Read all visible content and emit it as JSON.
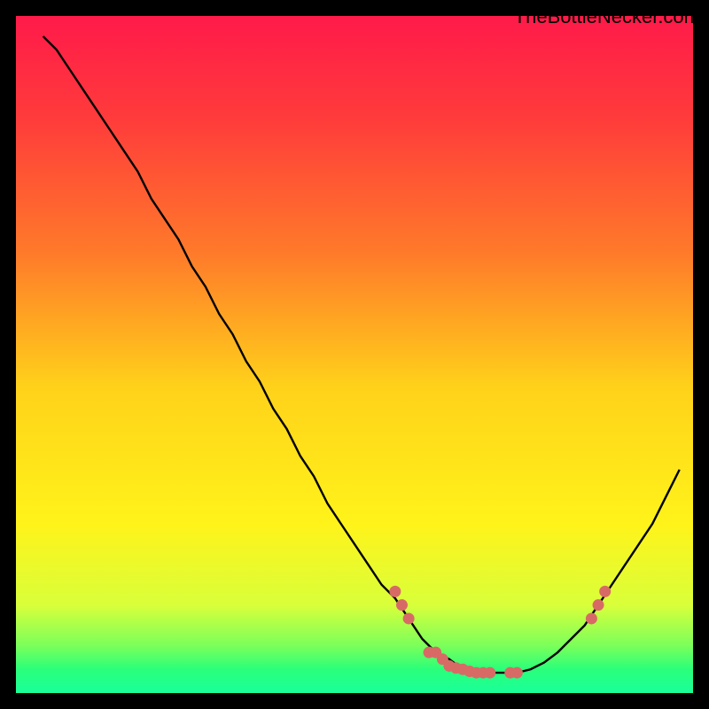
{
  "watermark": "TheBottleNecker.com",
  "chart_data": {
    "type": "line",
    "title": "",
    "xlabel": "",
    "ylabel": "",
    "xlim": [
      0,
      100
    ],
    "ylim": [
      0,
      100
    ],
    "x": [
      4,
      6,
      8,
      10,
      12,
      14,
      16,
      18,
      20,
      22,
      24,
      26,
      28,
      30,
      32,
      34,
      36,
      38,
      40,
      42,
      44,
      46,
      48,
      50,
      52,
      54,
      56,
      58,
      60,
      62,
      64,
      66,
      68,
      70,
      72,
      74,
      76,
      78,
      80,
      82,
      84,
      86,
      88,
      90,
      92,
      94,
      96,
      98
    ],
    "y": [
      97,
      95,
      92,
      89,
      86,
      83,
      80,
      77,
      73,
      70,
      67,
      63,
      60,
      56,
      53,
      49,
      46,
      42,
      39,
      35,
      32,
      28,
      25,
      22,
      19,
      16,
      14,
      11,
      8,
      6,
      5,
      3.5,
      3,
      3,
      3,
      3,
      3.5,
      4.5,
      6,
      8,
      10,
      13,
      16,
      19,
      22,
      25,
      29,
      33
    ],
    "markers": {
      "x": [
        56,
        57,
        58,
        61,
        62,
        63,
        64,
        65,
        66,
        67,
        68,
        69,
        70,
        73,
        74,
        85,
        86,
        87
      ],
      "y": [
        15,
        13,
        11,
        6,
        6,
        5,
        4,
        3.7,
        3.5,
        3.2,
        3,
        3,
        3,
        3,
        3,
        11,
        13,
        15
      ]
    },
    "gradient_stops": [
      {
        "offset": 0.0,
        "color": "#ff1a4a"
      },
      {
        "offset": 0.15,
        "color": "#ff3b3b"
      },
      {
        "offset": 0.35,
        "color": "#ff7a2a"
      },
      {
        "offset": 0.55,
        "color": "#ffd21a"
      },
      {
        "offset": 0.75,
        "color": "#fff31a"
      },
      {
        "offset": 0.87,
        "color": "#d9ff3a"
      },
      {
        "offset": 0.93,
        "color": "#7bff5a"
      },
      {
        "offset": 0.965,
        "color": "#2aff7a"
      },
      {
        "offset": 1.0,
        "color": "#1aff9a"
      }
    ],
    "marker_color": "#d86a66",
    "line_color": "#000000"
  }
}
